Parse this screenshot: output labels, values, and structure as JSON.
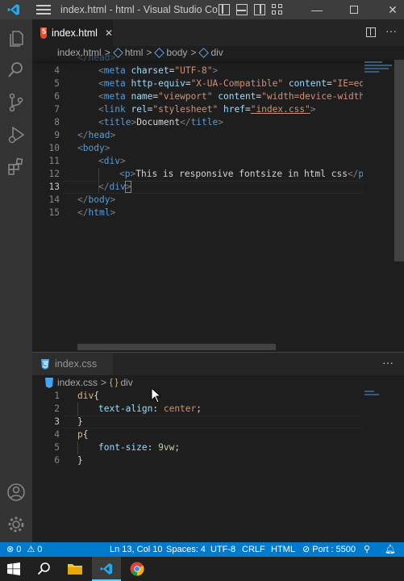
{
  "window": {
    "title": "index.html - html - Visual Studio Co..."
  },
  "top_editor": {
    "tab": {
      "label": "index.html",
      "close": "✕"
    },
    "breadcrumb": {
      "file": "index.html",
      "item1": "html",
      "item2": "body",
      "item3": "div"
    },
    "lines": [
      {
        "n": "4",
        "parts": [
          "<",
          "meta",
          " ",
          "charset",
          "=",
          "\"UTF-8\"",
          ">"
        ]
      },
      {
        "n": "5"
      },
      {
        "n": "6"
      },
      {
        "n": "7"
      },
      {
        "n": "8"
      },
      {
        "n": "9"
      },
      {
        "n": "10"
      },
      {
        "n": "11"
      },
      {
        "n": "12"
      },
      {
        "n": "13"
      },
      {
        "n": "14"
      },
      {
        "n": "15"
      }
    ],
    "code": {
      "l4a": "<",
      "l4b": "meta",
      "l4c": "charset",
      "l4d": "\"UTF-8\"",
      "l5b": "meta",
      "l5c": "http-equiv",
      "l5d": "\"X-UA-Compatible\"",
      "l5e": "content",
      "l5f": "\"IE=edge",
      "l6b": "meta",
      "l6c": "name",
      "l6d": "\"viewport\"",
      "l6e": "content",
      "l6f": "\"width=device-width,",
      "l7b": "link",
      "l7c": "rel",
      "l7d": "\"stylesheet\"",
      "l7e": "href",
      "l7f": "\"index.css\"",
      "l8b": "title",
      "l8t": "Document",
      "l8c": "title",
      "l9": "head",
      "l10": "body",
      "l11": "div",
      "l12b": "p",
      "l12t": "This is responsive fontsize in html css",
      "l12c": "p",
      "l13": "div",
      "l14": "body",
      "l15": "html",
      "l3": "head"
    }
  },
  "bottom_editor": {
    "tab": {
      "label": "index.css"
    },
    "more": "···",
    "breadcrumb": {
      "file": "index.css",
      "item1": "div"
    },
    "code": {
      "l1s": "div",
      "l1b": "{",
      "l2p": "text-align",
      "l2v": "center",
      "l3": "}",
      "l4s": "p",
      "l4b": "{",
      "l5p": "font-size",
      "l5v": "9vw",
      "l6": "}"
    }
  },
  "status": {
    "errors": "0",
    "warnings": "0",
    "position": "Ln 13, Col 10",
    "spaces": "Spaces: 4",
    "encoding": "UTF-8",
    "eol": "CRLF",
    "language": "HTML",
    "port": "Port : 5500"
  },
  "colors": {
    "accent": "#007acc",
    "activity": "#333333",
    "editor": "#1e1e1e"
  }
}
